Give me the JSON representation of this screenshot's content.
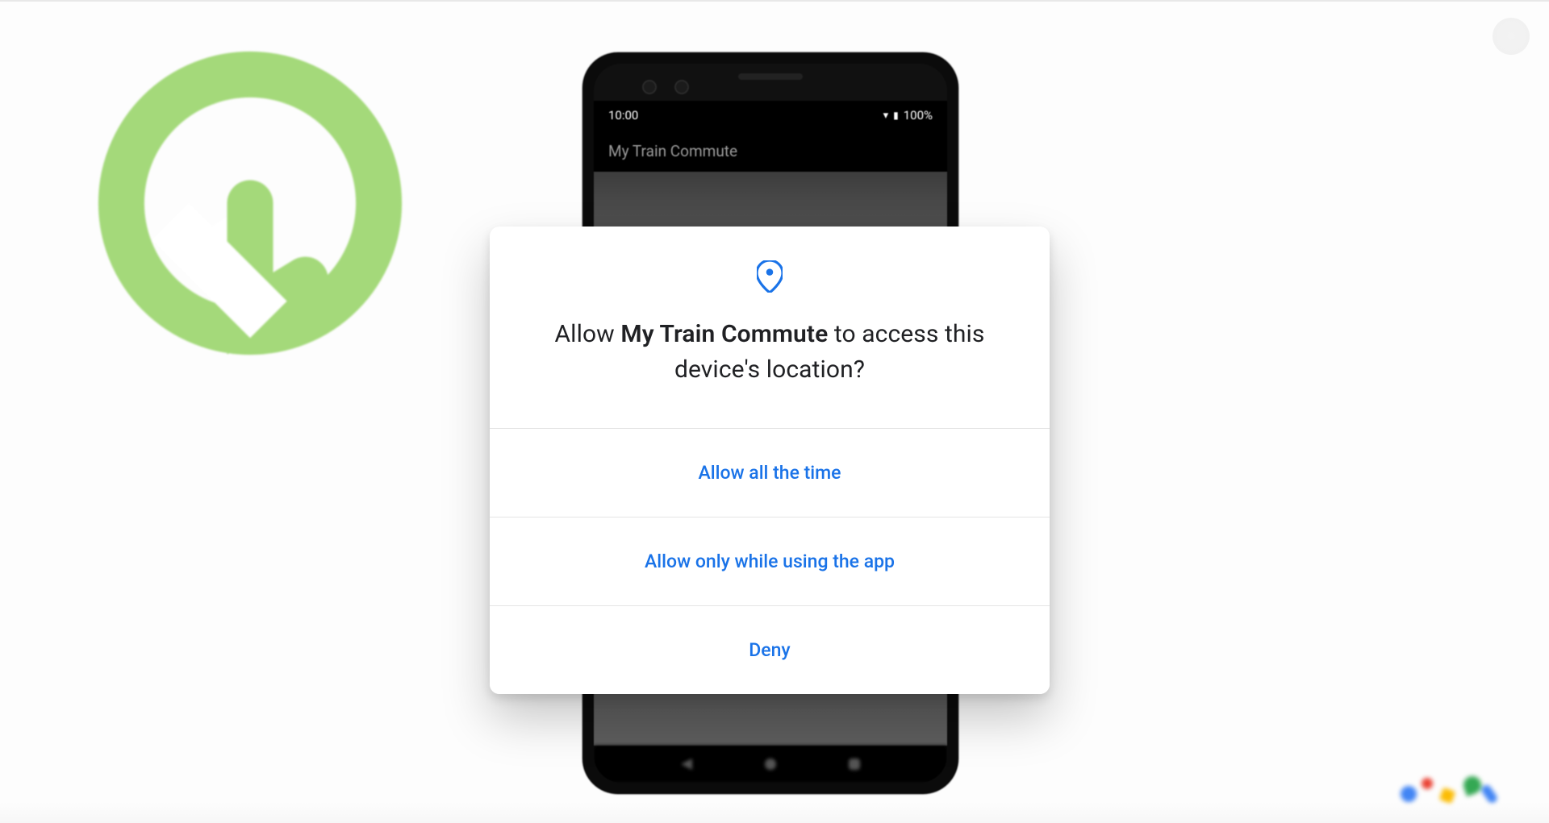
{
  "statusbar": {
    "time": "10:00",
    "battery_text": "100%"
  },
  "app": {
    "title": "My Train Commute"
  },
  "dialog": {
    "prompt_prefix": "Allow ",
    "prompt_app": "My Train Commute",
    "prompt_suffix": " to access this device's location?",
    "options": {
      "allow_always": "Allow all the time",
      "allow_while_using": "Allow only while using the app",
      "deny": "Deny"
    }
  },
  "colors": {
    "link": "#1a73e8",
    "q_logo": "#a4d97a"
  }
}
